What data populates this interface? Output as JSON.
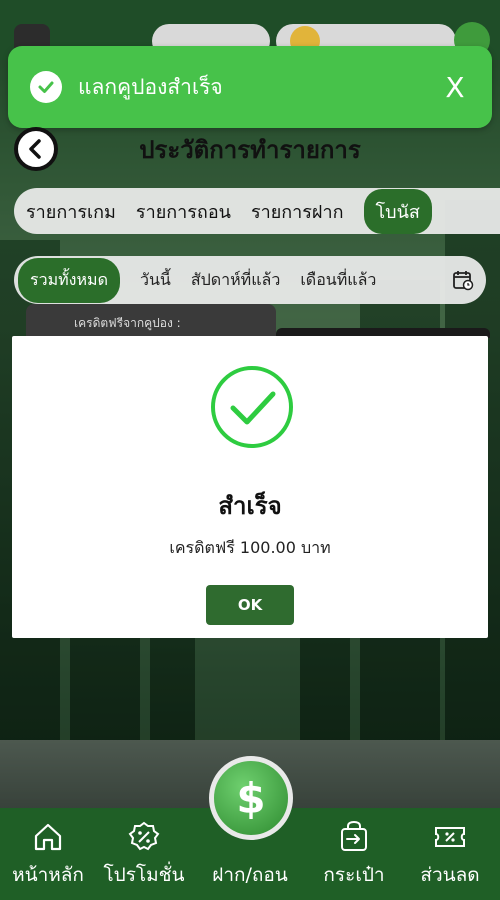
{
  "toast": {
    "message": "แลกคูปองสำเร็จ",
    "close_label": "X"
  },
  "header": {
    "title": "ประวัติการทำรายการ"
  },
  "tabs": [
    {
      "label": "รายการเกม"
    },
    {
      "label": "รายการถอน"
    },
    {
      "label": "รายการฝาก"
    },
    {
      "label": "โบนัส",
      "active": true
    }
  ],
  "filters": [
    {
      "label": "รวมทั้งหมด",
      "active": true
    },
    {
      "label": "วันนี้"
    },
    {
      "label": "สัปดาห์ที่แล้ว"
    },
    {
      "label": "เดือนที่แล้ว"
    }
  ],
  "coupon_card": {
    "label": "เครดิตฟรีจากคูปอง :"
  },
  "modal": {
    "title": "สำเร็จ",
    "message": "เครดิตฟรี 100.00 บาท",
    "ok_label": "OK"
  },
  "bottom_nav": {
    "items": [
      {
        "label": "หน้าหลัก",
        "icon": "home-icon"
      },
      {
        "label": "โปรโมชั่น",
        "icon": "promotion-icon"
      },
      {
        "label": "ฝาก/ถอน",
        "icon": "dollar-coin-icon"
      },
      {
        "label": "กระเป๋า",
        "icon": "wallet-icon"
      },
      {
        "label": "ส่วนลด",
        "icon": "discount-ticket-icon"
      }
    ]
  },
  "colors": {
    "toast_green": "#47c24a",
    "primary_green": "#2b6e2a",
    "nav_green": "#1f5f26",
    "check_green": "#2ecc40"
  }
}
